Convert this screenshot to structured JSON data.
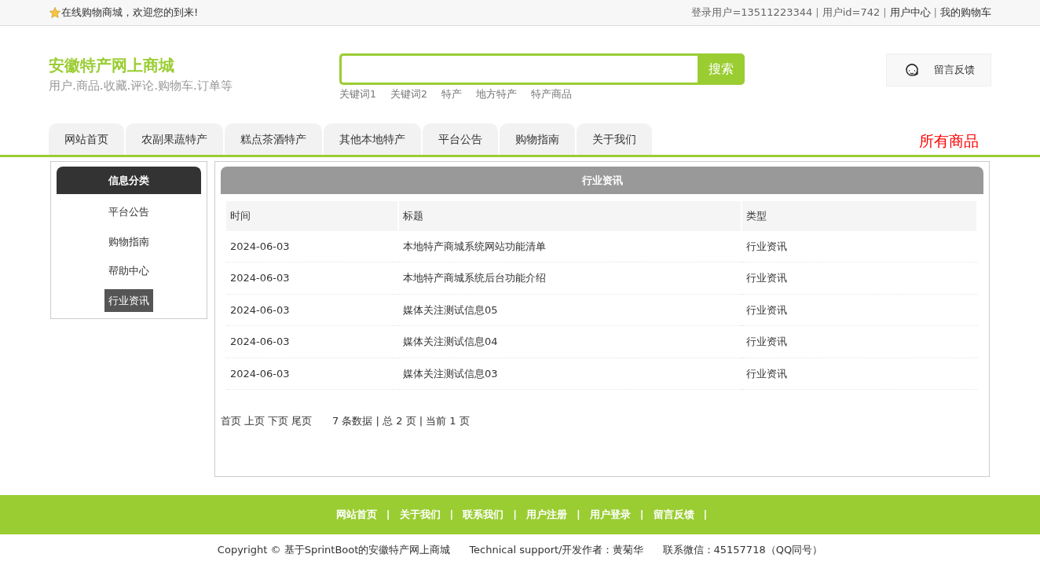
{
  "top_bar": {
    "welcome": "在线购物商城，欢迎您的到来!",
    "user_links": [
      {
        "kind": "text",
        "text": "登录用户=13511223344"
      },
      {
        "kind": "separator",
        "text": "|"
      },
      {
        "kind": "text",
        "text": "用户id=742"
      },
      {
        "kind": "separator",
        "text": "|"
      },
      {
        "kind": "link",
        "text": "用户中心"
      },
      {
        "kind": "separator",
        "text": "|"
      },
      {
        "kind": "link",
        "text": "我的购物车"
      }
    ]
  },
  "header": {
    "site_title": "安徽特产网上商城",
    "subtitle": "用户.商品.收藏.评论.购物车.订单等",
    "search": {
      "button": "搜索",
      "keywords": [
        "关键词1",
        "关键词2",
        "特产",
        "地方特产",
        "特产商品"
      ]
    },
    "feedback_button": "留言反馈"
  },
  "nav": {
    "tabs": [
      "网站首页",
      "农副果蔬特产",
      "糕点茶酒特产",
      "其他本地特产",
      "平台公告",
      "购物指南",
      "关于我们"
    ],
    "all_products": "所有商品"
  },
  "sidebar": {
    "title": "信息分类",
    "items": [
      {
        "label": "平台公告",
        "selected": false
      },
      {
        "label": "购物指南",
        "selected": false
      },
      {
        "label": "帮助中心",
        "selected": false
      },
      {
        "label": "行业资讯",
        "selected": true
      }
    ]
  },
  "main": {
    "title": "行业资讯",
    "table": {
      "columns": [
        "时间",
        "标题",
        "类型"
      ],
      "rows": [
        [
          "2024-06-03",
          "本地特产商城系统网站功能清单",
          "行业资讯"
        ],
        [
          "2024-06-03",
          "本地特产商城系统后台功能介绍",
          "行业资讯"
        ],
        [
          "2024-06-03",
          "媒体关注测试信息05",
          "行业资讯"
        ],
        [
          "2024-06-03",
          "媒体关注测试信息04",
          "行业资讯"
        ],
        [
          "2024-06-03",
          "媒体关注测试信息03",
          "行业资讯"
        ]
      ]
    },
    "pagination": {
      "links": [
        "首页",
        "上页",
        "下页",
        "尾页"
      ],
      "summary": "7 条数据 | 总 2 页 | 当前 1 页"
    }
  },
  "footer": {
    "links": [
      {
        "kind": "link",
        "text": "网站首页"
      },
      {
        "kind": "separator",
        "text": "|"
      },
      {
        "kind": "link",
        "text": "关于我们"
      },
      {
        "kind": "separator",
        "text": "|"
      },
      {
        "kind": "link",
        "text": "联系我们"
      },
      {
        "kind": "separator",
        "text": "|"
      },
      {
        "kind": "link",
        "text": "用户注册"
      },
      {
        "kind": "separator",
        "text": "|"
      },
      {
        "kind": "link",
        "text": "用户登录"
      },
      {
        "kind": "separator",
        "text": "|"
      },
      {
        "kind": "link",
        "text": "留言反馈"
      },
      {
        "kind": "separator",
        "text": "|"
      }
    ],
    "copyright": "Copyright © 基于SprintBoot的安徽特产网上商城",
    "support": "Technical support/开发作者：黄菊华",
    "contact": "联系微信：45157718（QQ同号）"
  }
}
